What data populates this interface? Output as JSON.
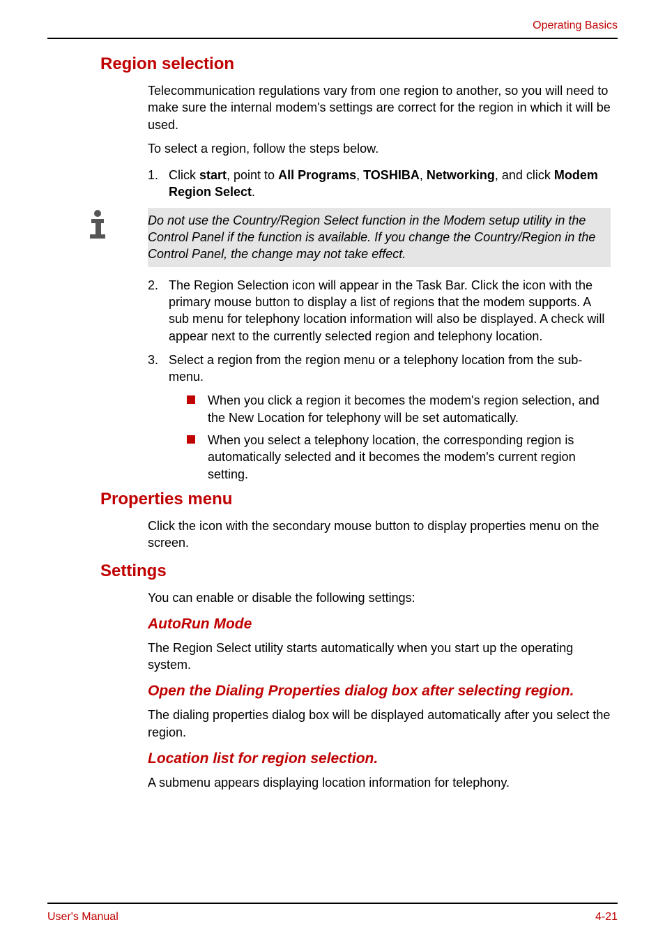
{
  "header": {
    "section": "Operating Basics"
  },
  "footer": {
    "left": "User's Manual",
    "right": "4-21"
  },
  "s1": {
    "title": "Region selection",
    "p1": "Telecommunication regulations vary from one region to another, so you will need to make sure the internal modem's settings are correct for the region in which it will be used.",
    "p2": "To select a region, follow the steps below.",
    "li1": {
      "num": "1.",
      "pre": "Click ",
      "b1": "start",
      "t1": ", point to ",
      "b2": "All Programs",
      "t2": ", ",
      "b3": "TOSHIBA",
      "t3": ", ",
      "b4": "Networking",
      "t4": ", and click ",
      "b5": "Modem Region Select",
      "t5": "."
    },
    "note": "Do not use the Country/Region Select function in the Modem setup utility in the Control Panel if the function is available. If you change the Country/Region in the Control Panel, the change may not take effect.",
    "li2": {
      "num": "2.",
      "text": "The Region Selection icon will appear in the Task Bar. Click the icon with the primary mouse button to display a list of regions that the modem supports. A sub menu for telephony location information will also be displayed. A check will appear next to the currently selected region and telephony location."
    },
    "li3": {
      "num": "3.",
      "text": "Select a region from the region menu or a telephony location from the sub-menu."
    },
    "b1": "When you click a region it becomes the modem's region selection, and the New Location for telephony will be set automatically.",
    "b2": "When you select a telephony location, the corresponding region is automatically selected and it becomes the modem's current region setting."
  },
  "s2": {
    "title": "Properties menu",
    "p1": "Click the icon with the secondary mouse button to display properties menu on the screen."
  },
  "s3": {
    "title": "Settings",
    "p1": "You can enable or disable the following settings:",
    "h3a": "AutoRun Mode",
    "pa": "The Region Select utility starts automatically when you start up the operating system.",
    "h3b": "Open the Dialing Properties dialog box after selecting region.",
    "pb": "The dialing properties dialog box will be displayed automatically after you select the region.",
    "h3c": "Location list for region selection.",
    "pc": "A submenu appears displaying location information for telephony."
  }
}
